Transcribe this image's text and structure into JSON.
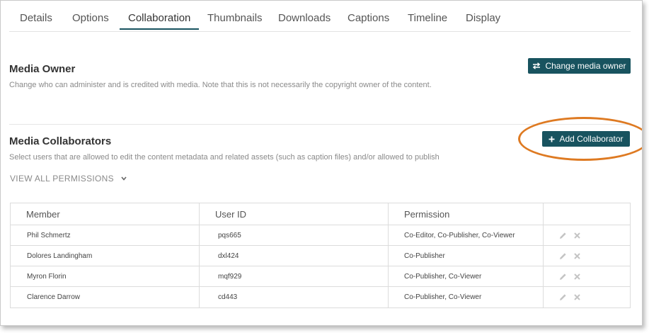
{
  "tabs": [
    {
      "label": "Details"
    },
    {
      "label": "Options"
    },
    {
      "label": "Collaboration",
      "active": true
    },
    {
      "label": "Thumbnails"
    },
    {
      "label": "Downloads"
    },
    {
      "label": "Captions"
    },
    {
      "label": "Timeline"
    },
    {
      "label": "Display"
    }
  ],
  "media_owner": {
    "title": "Media Owner",
    "description": "Change who can administer and is credited with media. Note that this is not necessarily the copyright owner of the content.",
    "button_label": "Change media owner",
    "button_icon": "swap-arrows-icon"
  },
  "media_collaborators": {
    "title": "Media Collaborators",
    "description": "Select users that are allowed to edit the content metadata and related assets (such as caption files) and/or allowed to publish",
    "button_label": "Add Collaborator",
    "button_icon": "plus-icon",
    "view_all_label": "VIEW ALL PERMISSIONS"
  },
  "table": {
    "columns": [
      "Member",
      "User ID",
      "Permission",
      ""
    ],
    "rows": [
      {
        "member": "Phil Schmertz",
        "user_id": "pqs665",
        "permission": "Co-Editor, Co-Publisher, Co-Viewer"
      },
      {
        "member": "Dolores Landingham",
        "user_id": "dxl424",
        "permission": "Co-Publisher"
      },
      {
        "member": "Myron Florin",
        "user_id": "mqf929",
        "permission": "Co-Publisher, Co-Viewer"
      },
      {
        "member": "Clarence Darrow",
        "user_id": "cd443",
        "permission": "Co-Publisher, Co-Viewer"
      }
    ]
  },
  "colors": {
    "button_bg": "#18535f",
    "callout": "#de7a22",
    "action_icons": "#c4c4c4"
  }
}
